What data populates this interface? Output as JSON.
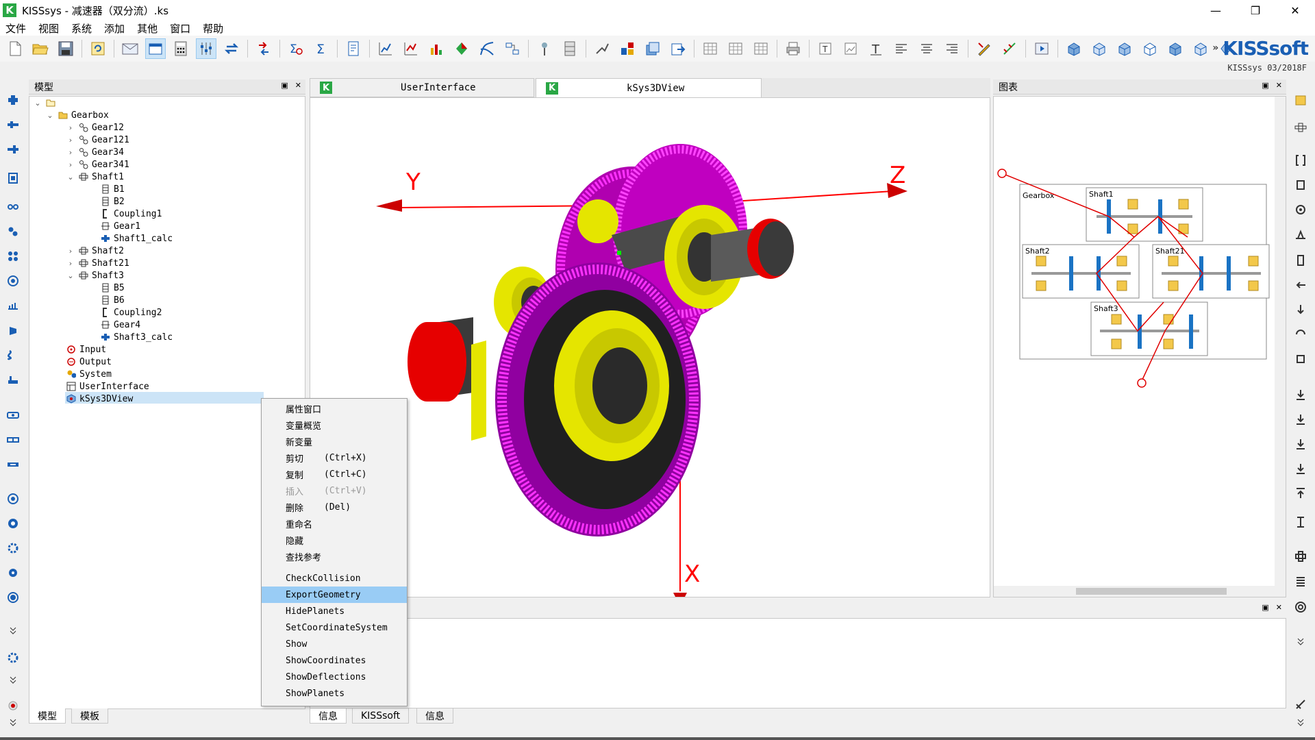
{
  "window": {
    "title": "KISSsys -                 减速器（双分流）.ks",
    "minimize": "—",
    "maximize": "❐",
    "close": "✕"
  },
  "menu": [
    "文件",
    "视图",
    "系统",
    "添加",
    "其他",
    "窗口",
    "帮助"
  ],
  "brand": {
    "logo": "KISSsoft",
    "more": "»",
    "version": "KISSsys 03/2018F"
  },
  "model_panel": {
    "title": "模型",
    "tree": [
      {
        "label": "Gearbox"
      },
      {
        "label": "Gear12"
      },
      {
        "label": "Gear121"
      },
      {
        "label": "Gear34"
      },
      {
        "label": "Gear341"
      },
      {
        "label": "Shaft1"
      },
      {
        "label": "B1"
      },
      {
        "label": "B2"
      },
      {
        "label": "Coupling1"
      },
      {
        "label": "Gear1"
      },
      {
        "label": "Shaft1_calc"
      },
      {
        "label": "Shaft2"
      },
      {
        "label": "Shaft21"
      },
      {
        "label": "Shaft3"
      },
      {
        "label": "B5"
      },
      {
        "label": "B6"
      },
      {
        "label": "Coupling2"
      },
      {
        "label": "Gear4"
      },
      {
        "label": "Shaft3_calc"
      },
      {
        "label": "Input"
      },
      {
        "label": "Output"
      },
      {
        "label": "System"
      },
      {
        "label": "UserInterface"
      },
      {
        "label": "kSys3DView"
      }
    ],
    "bottom_tabs": [
      "模型",
      "模板"
    ]
  },
  "doc_tabs": [
    {
      "label": "UserInterface"
    },
    {
      "label": "kSys3DView"
    }
  ],
  "view3d": {
    "axis_x": "X",
    "axis_y": "Y",
    "axis_z": "Z"
  },
  "diagram_panel": {
    "title": "图表",
    "labels": {
      "gearbox": "Gearbox",
      "shaft1": "Shaft1",
      "shaft2": "Shaft2",
      "shaft21": "Shaft21",
      "shaft3": "Shaft3"
    }
  },
  "info_panel": {
    "tabs": [
      "信息",
      "KISSsoft",
      "信息"
    ]
  },
  "context_menu": {
    "items": [
      {
        "label": "属性窗口",
        "shortcut": ""
      },
      {
        "label": "变量概览",
        "shortcut": ""
      },
      {
        "label": "新变量",
        "shortcut": ""
      },
      {
        "label": "剪切",
        "shortcut": "(Ctrl+X)"
      },
      {
        "label": "复制",
        "shortcut": "(Ctrl+C)"
      },
      {
        "label": "插入",
        "shortcut": "(Ctrl+V)",
        "disabled": true
      },
      {
        "label": "删除",
        "shortcut": "(Del)"
      },
      {
        "label": "重命名",
        "shortcut": ""
      },
      {
        "label": "隐藏",
        "shortcut": ""
      },
      {
        "label": "查找参考",
        "shortcut": ""
      }
    ],
    "custom_items": [
      {
        "label": "CheckCollision"
      },
      {
        "label": "ExportGeometry",
        "highlighted": true
      },
      {
        "label": "HidePlanets"
      },
      {
        "label": "SetCoordinateSystem"
      },
      {
        "label": "Show"
      },
      {
        "label": "ShowCoordinates"
      },
      {
        "label": "ShowDeflections"
      },
      {
        "label": "ShowPlanets"
      }
    ]
  },
  "colors": {
    "accent": "#1a5fb4",
    "gear": "#cc00cc",
    "bearing": "#e5e500",
    "shaft_end": "#e60000",
    "axis": "#ff0000",
    "selection": "#cce4f7",
    "menu_highlight": "#99ccf5"
  }
}
